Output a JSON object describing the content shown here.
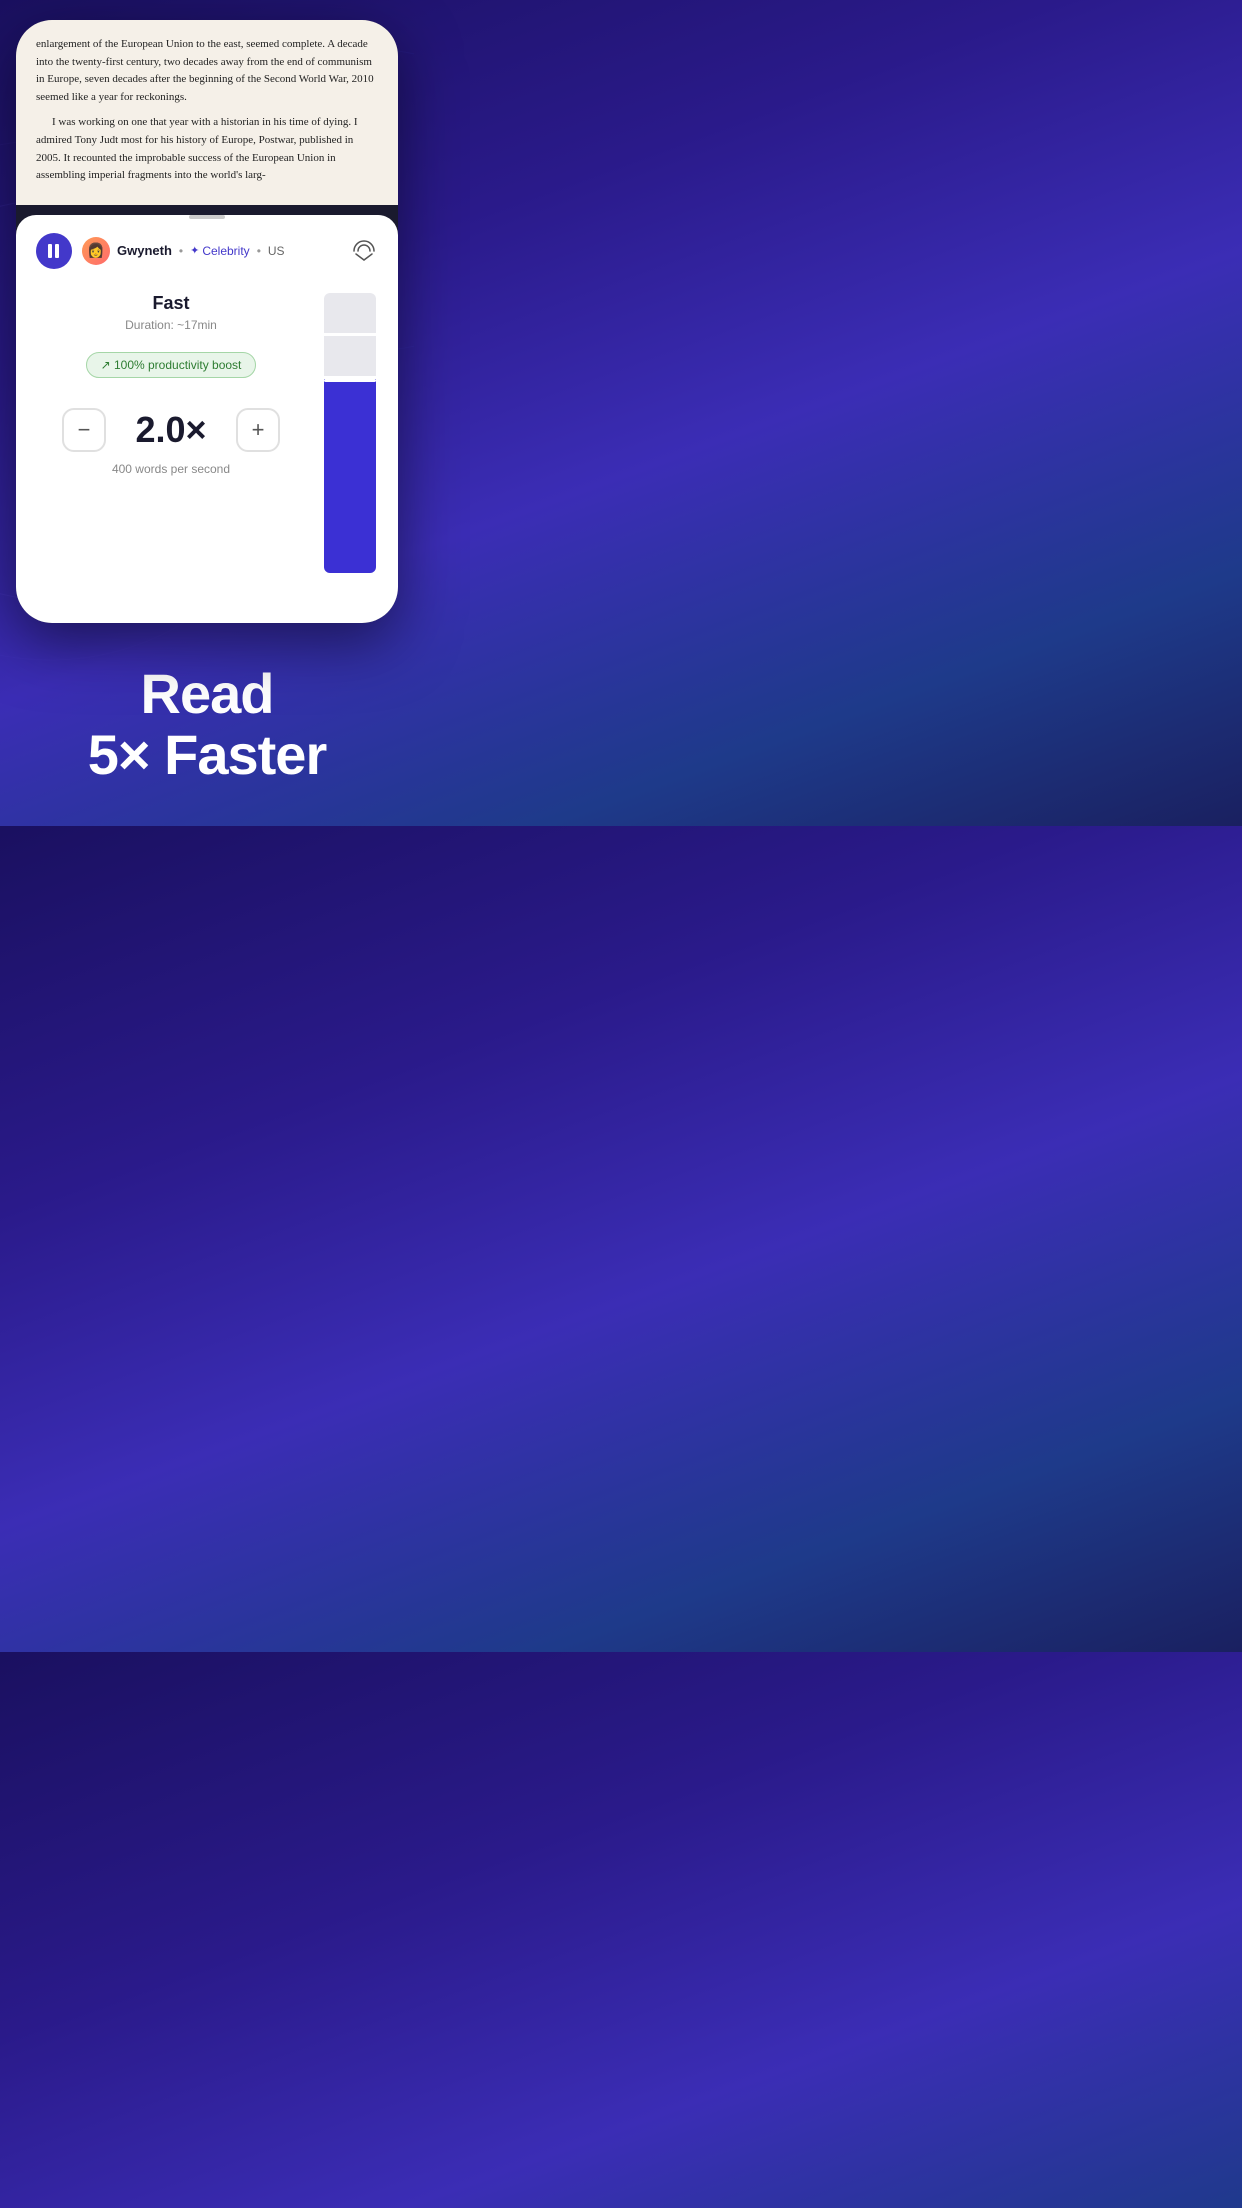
{
  "background": {
    "gradient_from": "#1a1060",
    "gradient_to": "#1a2060"
  },
  "book_text": {
    "paragraph1": "enlargement of the European Union to the east, seemed complete. A decade into the twenty-first century, two decades away from the end of communism in Europe, seven decades after the beginning of the Second World War, 2010 seemed like a year for reckonings.",
    "paragraph2": "I was working on one that year with a historian in his time of dying. I admired Tony Judt most for his history of Europe, Postwar, published in 2005. It recounted the improbable success of the European Union in assembling imperial fragments into the world's larg-"
  },
  "voice_bar": {
    "pause_label": "pause",
    "avatar_emoji": "👩",
    "voice_name": "Gwyneth",
    "dot": "•",
    "sparkle": "✦",
    "voice_tag": "Celebrity",
    "region": "US",
    "airplay_label": "airplay"
  },
  "speed_panel": {
    "speed_name": "Fast",
    "duration_label": "Duration: ~17min",
    "productivity_badge": "↗ 100% productivity boost",
    "speed_value": "2.0×",
    "minus_label": "−",
    "plus_label": "+",
    "wps_label": "400 words per second"
  },
  "tagline": {
    "line1": "Read",
    "line2": "5× Faster"
  }
}
